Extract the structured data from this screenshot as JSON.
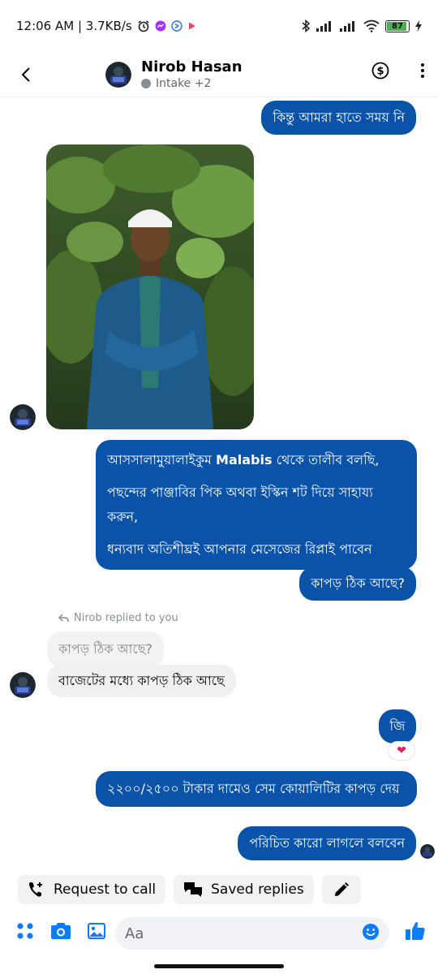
{
  "status_bar": {
    "time_speed": "12:06 AM | 3.7KB/s",
    "battery": "87",
    "colors": {
      "messenger": "#a033ff",
      "play": "#ff3d6a",
      "battery_fill": "#4caf50"
    }
  },
  "header": {
    "name": "Nirob Hasan",
    "subtitle": "Intake +2",
    "icons": [
      "back-arrow-icon",
      "dollar-icon",
      "more-vertical-icon"
    ]
  },
  "colors": {
    "outgoing_bubble": "#0a53a8",
    "incoming_bubble": "#f0f0f0",
    "accent": "#0a7cff"
  },
  "messages": {
    "msg1": "কিন্তু আমরা হাতে সময় নি",
    "welcome_part1": "আসসালামুয়ালাইকুম ",
    "welcome_brand": "Malabis",
    "welcome_part2": " থেকে তালীব বলছি,",
    "welcome_line2": "পছন্দের পাঞ্জাবির পিক অথবা ইস্কিন শট দিয়ে সাহায্য করুন,",
    "welcome_line3": "ধন্যবাদ অতিশীঘ্রই আপনার মেসেজের রিপ্লাই পাবেন",
    "msg_cloth_ok": "কাপড় ঠিক আছে?",
    "reply_note": "Nirob replied to you",
    "quoted": "কাপড় ঠিক আছে?",
    "incoming_reply": "বাজেটের মধ্যে কাপড় ঠিক আছে",
    "msg_ji": "জি",
    "reaction": "heart",
    "msg_price": "২২০০/২৫০০ টাকার দামেও সেম কোয়ালিটির কাপড় দেয়",
    "msg_refer": "পরিচিত কারো লাগলে বলবেন"
  },
  "quick_actions": {
    "request_call": "Request to call",
    "saved_replies": "Saved replies"
  },
  "composer": {
    "placeholder": "Aa",
    "icons": [
      "menu-dots-icon",
      "camera-icon",
      "gallery-icon",
      "emoji-icon",
      "thumbs-up-icon"
    ]
  }
}
